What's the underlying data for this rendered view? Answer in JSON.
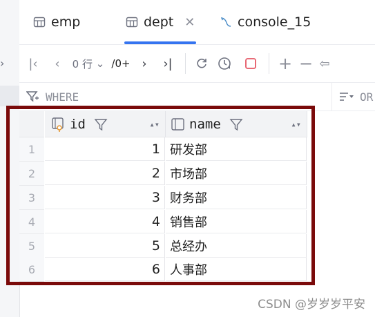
{
  "tabs": [
    {
      "label": "emp",
      "icon": "table-icon",
      "active": false
    },
    {
      "label": "dept",
      "icon": "table-icon",
      "active": true
    },
    {
      "label": "console_15",
      "icon": "mysql-console-icon",
      "active": false
    }
  ],
  "toolbar": {
    "rows_label": "0 行",
    "page_label": "/0+"
  },
  "filter": {
    "where_label": "WHERE",
    "order_label": "OR"
  },
  "columns": [
    {
      "name": "id",
      "icon": "key-column-icon"
    },
    {
      "name": "name",
      "icon": "column-icon"
    }
  ],
  "rows": [
    {
      "num": "1",
      "id": "1",
      "name": "研发部"
    },
    {
      "num": "2",
      "id": "2",
      "name": "市场部"
    },
    {
      "num": "3",
      "id": "3",
      "name": "财务部"
    },
    {
      "num": "4",
      "id": "4",
      "name": "销售部"
    },
    {
      "num": "5",
      "id": "5",
      "name": "总经办"
    },
    {
      "num": "6",
      "id": "6",
      "name": "人事部"
    }
  ],
  "watermark": "CSDN @岁岁岁平安",
  "colors": {
    "accent": "#3574f0",
    "highlight": "#7a0a0a"
  }
}
